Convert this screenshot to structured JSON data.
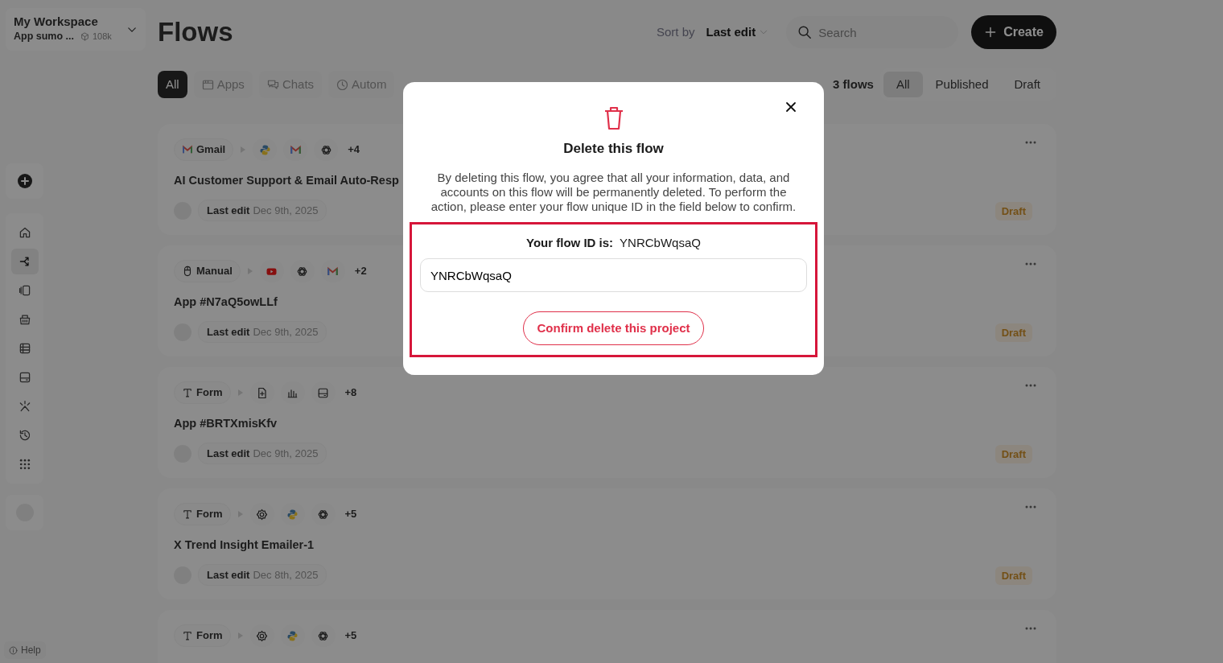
{
  "workspace": {
    "name": "My Workspace",
    "plan": "App sumo ...",
    "credits": "108k"
  },
  "sidebar": {
    "items": [
      {
        "kind": "home",
        "selected": false
      },
      {
        "kind": "flow",
        "selected": true
      },
      {
        "kind": "pages",
        "selected": false
      },
      {
        "kind": "basket",
        "selected": false
      },
      {
        "kind": "table",
        "selected": false
      },
      {
        "kind": "panel",
        "selected": false
      },
      {
        "kind": "sparkle",
        "selected": false
      },
      {
        "kind": "history",
        "selected": false
      },
      {
        "kind": "grid",
        "selected": false
      }
    ],
    "help": "Help"
  },
  "header": {
    "title": "Flows",
    "sort_label": "Sort by",
    "sort_value": "Last edit",
    "search": {
      "placeholder": "Search"
    },
    "create": "Create"
  },
  "type_tabs": [
    {
      "kind": "all",
      "label": "All",
      "selected": true
    },
    {
      "kind": "apps",
      "label": "Apps",
      "selected": false
    },
    {
      "kind": "chats",
      "label": "Chats",
      "selected": false
    },
    {
      "kind": "clock",
      "label": "Autom",
      "selected": false
    }
  ],
  "flow_count": "3 flows",
  "status_tabs": [
    {
      "label": "All",
      "selected": true
    },
    {
      "label": "Published",
      "selected": false
    },
    {
      "label": "Draft",
      "selected": false
    }
  ],
  "flows": [
    {
      "trigger": {
        "kind": "gmail",
        "label": "Gmail"
      },
      "steps": [
        {
          "kind": "python"
        },
        {
          "kind": "gmail"
        },
        {
          "kind": "openai"
        }
      ],
      "more": "+4",
      "title": "AI Customer Support & Email Auto-Resp",
      "edit_label": "Last edit",
      "edit_date": "Dec 9th, 2025",
      "status": "Draft"
    },
    {
      "trigger": {
        "kind": "mouse",
        "label": "Manual"
      },
      "steps": [
        {
          "kind": "youtube"
        },
        {
          "kind": "openai"
        },
        {
          "kind": "gmail"
        }
      ],
      "more": "+2",
      "title": "App #N7aQ5owLLf",
      "edit_label": "Last edit",
      "edit_date": "Dec 9th, 2025",
      "status": "Draft"
    },
    {
      "trigger": {
        "kind": "text",
        "label": "Form"
      },
      "steps": [
        {
          "kind": "file"
        },
        {
          "kind": "chart"
        },
        {
          "kind": "panel"
        }
      ],
      "more": "+8",
      "title": "App #BRTXmisKfv",
      "edit_label": "Last edit",
      "edit_date": "Dec 9th, 2025",
      "status": "Draft"
    },
    {
      "trigger": {
        "kind": "text",
        "label": "Form"
      },
      "steps": [
        {
          "kind": "gear"
        },
        {
          "kind": "python"
        },
        {
          "kind": "openai"
        }
      ],
      "more": "+5",
      "title": "X Trend Insight Emailer-1",
      "edit_label": "Last edit",
      "edit_date": "Dec 8th, 2025",
      "status": "Draft"
    },
    {
      "trigger": {
        "kind": "text",
        "label": "Form"
      },
      "steps": [
        {
          "kind": "gear"
        },
        {
          "kind": "python"
        },
        {
          "kind": "openai"
        }
      ],
      "more": "+5"
    }
  ],
  "dialog": {
    "title": "Delete this flow",
    "message": "By deleting this flow, you agree that all your information, data, and accounts on this flow will be permanently deleted. To perform the action, please enter your flow unique ID in the field below to confirm.",
    "id_label": "Your flow ID is:",
    "id_value": "YNRCbWqsaQ",
    "input_value": "YNRCbWqsaQ",
    "confirm": "Confirm delete this project"
  }
}
